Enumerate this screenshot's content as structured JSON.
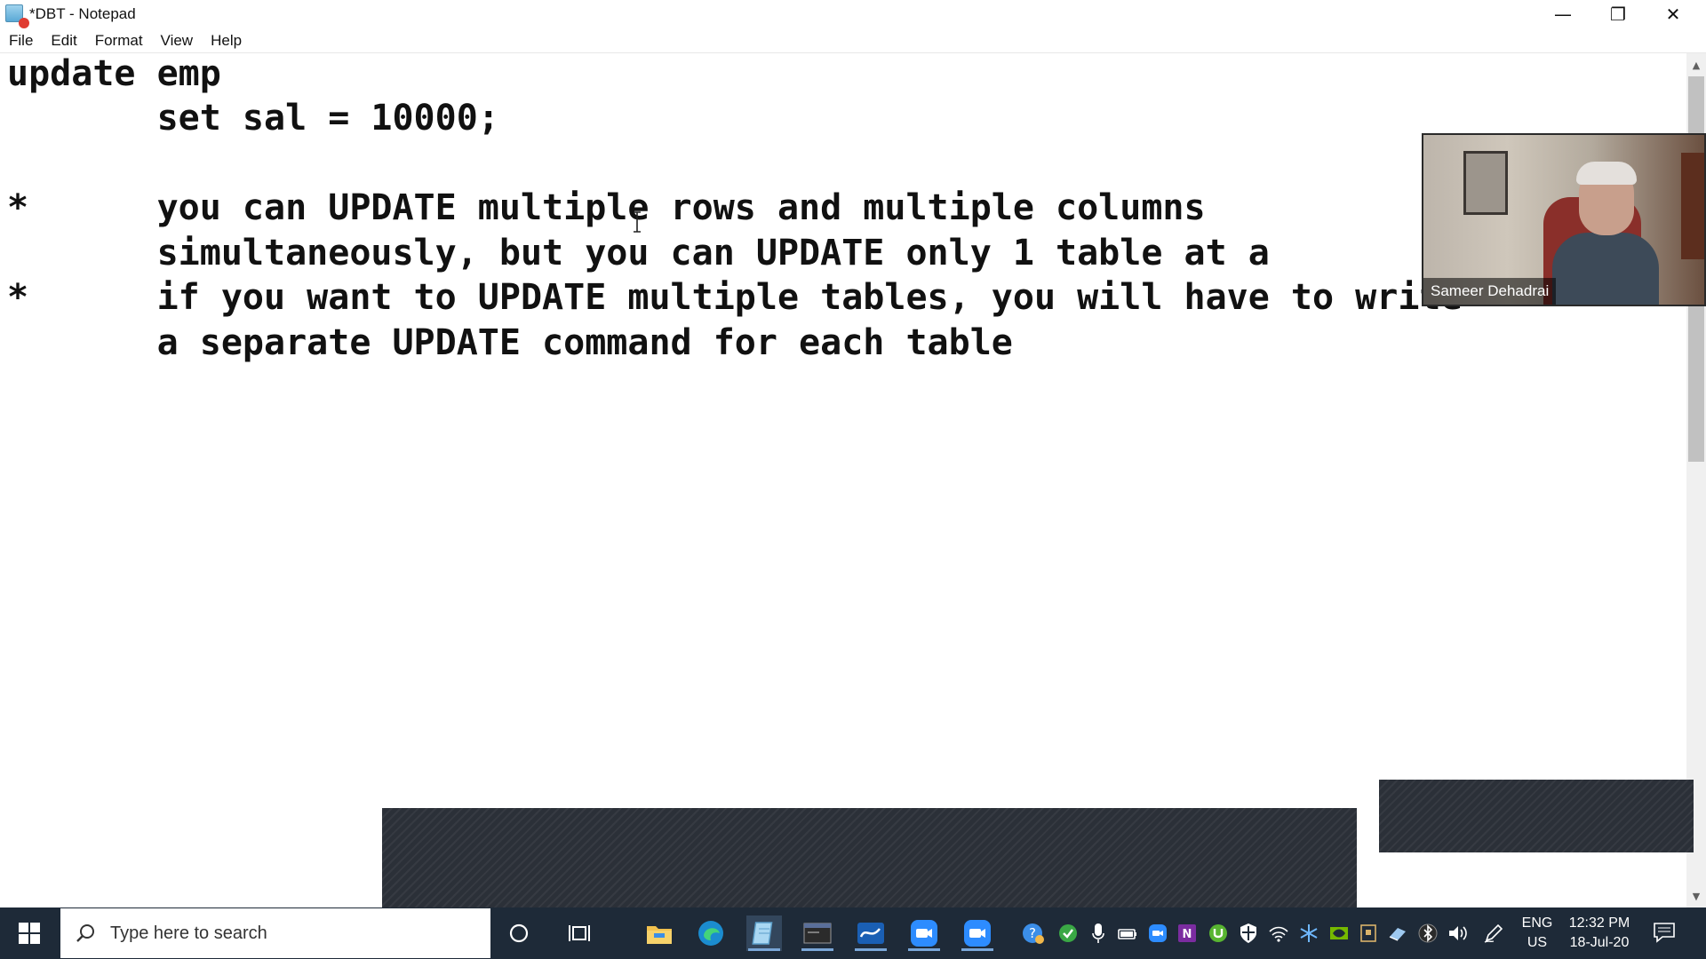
{
  "window": {
    "title": "*DBT - Notepad",
    "minimize": "—",
    "maximize": "❐",
    "close": "✕"
  },
  "menu": {
    "items": [
      "File",
      "Edit",
      "Format",
      "View",
      "Help"
    ]
  },
  "editor": {
    "lines": [
      "update emp",
      "       set sal = 10000;",
      "",
      "*      you can UPDATE multiple rows and multiple columns",
      "       simultaneously, but you can UPDATE only 1 table at a",
      "*      if you want to UPDATE multiple tables, you will have to write",
      "       a separate UPDATE command for each table"
    ]
  },
  "webcam": {
    "participant_name": "Sameer Dehadrai"
  },
  "taskbar": {
    "search_placeholder": "Type here to search",
    "language": "ENG",
    "region": "US",
    "time": "12:32 PM",
    "date": "18-Jul-20"
  },
  "icons": {
    "app": "notepad-icon",
    "search": "search-icon",
    "cortana": "cortana-icon",
    "task_view": "task-view-icon",
    "pinned": [
      "file-explorer-icon",
      "edge-icon",
      "notepad-icon",
      "sql-plus-icon",
      "whiteboard-icon",
      "zoom-icon",
      "zoom-meeting-icon"
    ]
  },
  "colors": {
    "taskbar_bg": "#1e2a38",
    "text": "#111111",
    "hatch": "#2b3038",
    "accent": "#7aa7d8"
  }
}
